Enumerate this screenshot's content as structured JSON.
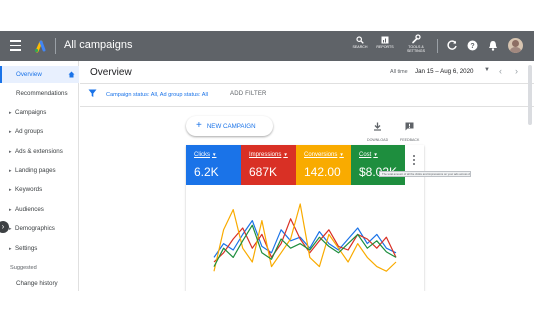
{
  "header": {
    "title": "All campaigns",
    "tools": [
      {
        "icon": "search-icon",
        "label": "SEARCH"
      },
      {
        "icon": "reports-icon",
        "label": "REPORTS"
      },
      {
        "icon": "wrench-icon",
        "label": "TOOLS & SETTINGS"
      }
    ]
  },
  "sidebar": {
    "items": [
      {
        "label": "Overview",
        "active": true
      },
      {
        "label": "Recommendations"
      },
      {
        "label": "Campaigns",
        "caret": true
      },
      {
        "label": "Ad groups",
        "caret": true
      },
      {
        "label": "Ads & extensions",
        "caret": true
      },
      {
        "label": "Landing pages",
        "caret": true
      },
      {
        "label": "Keywords",
        "caret": true
      },
      {
        "label": "Audiences",
        "caret": true
      },
      {
        "label": "Demographics",
        "caret": true
      },
      {
        "label": "Settings",
        "caret": true
      }
    ],
    "section_label": "Suggested",
    "extra_item": "Change history"
  },
  "main": {
    "title": "Overview",
    "date_label": "All time",
    "date_range": "Jan 15 – Aug 6, 2020",
    "filter_text": "Campaign status: All, Ad group status: All",
    "add_filter": "ADD FILTER",
    "new_campaign": "NEW CAMPAIGN",
    "download_label": "DOWNLOAD",
    "feedback_label": "FEEDBACK",
    "tooltip": "The total amount of all the clicks and impressions on your ads across clicks"
  },
  "metrics": [
    {
      "label": "Clicks",
      "value": "6.2K",
      "color": "#1a73e8"
    },
    {
      "label": "Impressions",
      "value": "687K",
      "color": "#d93025"
    },
    {
      "label": "Conversions",
      "value": "142.00",
      "color": "#f9ab00"
    },
    {
      "label": "Cost",
      "value": "$8.02K",
      "color": "#1e8e3e"
    }
  ],
  "chart_data": {
    "type": "line",
    "x": [
      1,
      2,
      3,
      4,
      5,
      6,
      7,
      8,
      9,
      10,
      11,
      12,
      13,
      14,
      15,
      16,
      17,
      18,
      19,
      20
    ],
    "series": [
      {
        "color": "#1a73e8",
        "values": [
          30,
          45,
          38,
          55,
          70,
          42,
          35,
          60,
          48,
          52,
          40,
          58,
          45,
          38,
          50,
          62,
          45,
          55,
          40,
          35
        ]
      },
      {
        "color": "#d93025",
        "values": [
          25,
          35,
          50,
          62,
          40,
          55,
          30,
          45,
          72,
          50,
          35,
          48,
          60,
          42,
          38,
          55,
          50,
          40,
          52,
          30
        ]
      },
      {
        "color": "#f9ab00",
        "values": [
          15,
          60,
          82,
          40,
          25,
          70,
          20,
          35,
          50,
          88,
          30,
          20,
          55,
          40,
          25,
          45,
          30,
          20,
          15,
          25
        ]
      },
      {
        "color": "#1e8e3e",
        "values": [
          20,
          40,
          30,
          48,
          65,
          35,
          28,
          50,
          40,
          45,
          38,
          52,
          42,
          35,
          45,
          55,
          40,
          48,
          36,
          30
        ]
      }
    ]
  }
}
